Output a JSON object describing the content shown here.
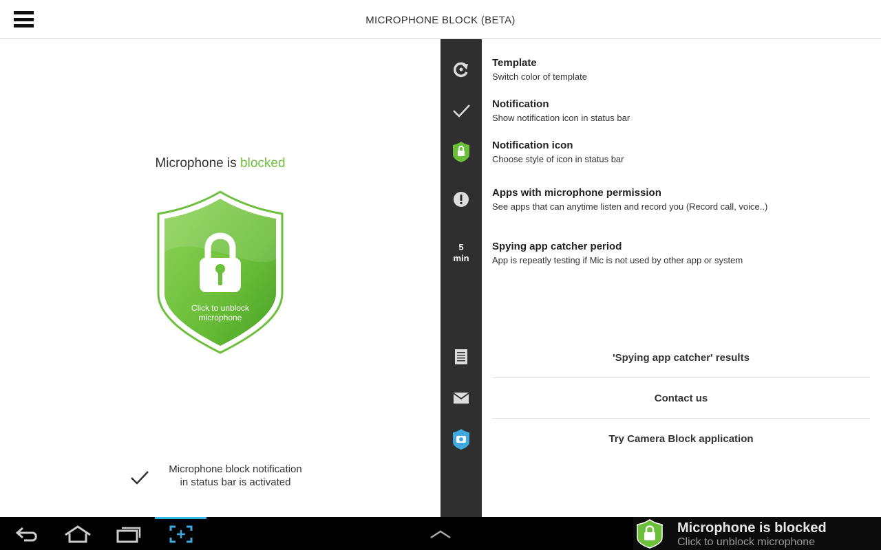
{
  "header": {
    "title": "MICROPHONE BLOCK (BETA)"
  },
  "left_panel": {
    "status_prefix": "Microphone is ",
    "status_value": "blocked",
    "shield_label_line1": "Click to unblock",
    "shield_label_line2": "microphone",
    "notification_line1": "Microphone block notification",
    "notification_line2": "in status bar is activated"
  },
  "rail": {
    "period_value": "5",
    "period_unit": "min"
  },
  "settings": {
    "items": [
      {
        "title": "Template",
        "subtitle": "Switch color of template",
        "icon": "refresh-icon"
      },
      {
        "title": "Notification",
        "subtitle": "Show notification icon in status bar",
        "icon": "check-icon"
      },
      {
        "title": "Notification icon",
        "subtitle": "Choose style of icon in status bar",
        "icon": "lock-shield-icon"
      },
      {
        "title": "Apps with microphone permission",
        "subtitle": "See apps that can anytime listen and record you (Record call, voice..)",
        "icon": "alert-icon"
      },
      {
        "title": "Spying app catcher period",
        "subtitle": "App is repeatly testing if Mic is not used by other app or system",
        "icon": "period-value"
      }
    ],
    "links": [
      {
        "label": "'Spying app catcher' results",
        "icon": "document-icon"
      },
      {
        "label": "Contact us",
        "icon": "mail-icon"
      },
      {
        "label": "Try Camera Block application",
        "icon": "camera-shield-icon"
      }
    ]
  },
  "system_bar": {
    "notification_title": "Microphone is blocked",
    "notification_subtitle": "Click to unblock microphone"
  },
  "colors": {
    "accent_green": "#6cbf3a",
    "rail_bg": "#2f2f2f",
    "system_bar_bg": "#000000",
    "holo_blue": "#33b5e5"
  }
}
